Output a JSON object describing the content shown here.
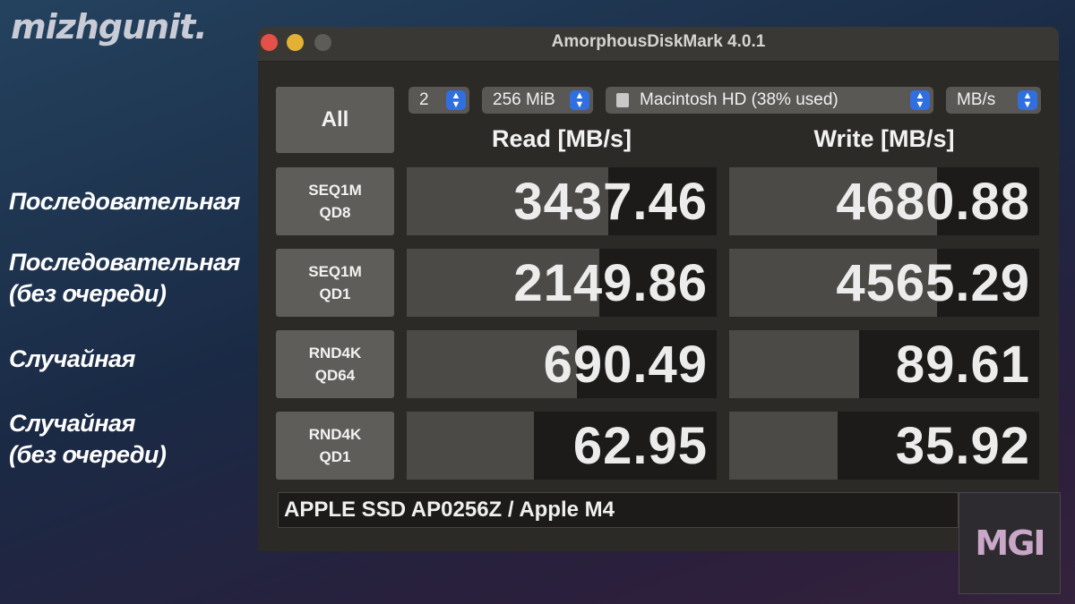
{
  "brand": "mizhgunit.",
  "side_labels": [
    {
      "line1": "Последовательная",
      "line2": ""
    },
    {
      "line1": "Последовательная",
      "line2": "(без очереди)"
    },
    {
      "line1": "Случайная",
      "line2": ""
    },
    {
      "line1": "Случайная",
      "line2": "(без очереди)"
    }
  ],
  "window": {
    "title": "AmorphousDiskMark 4.0.1",
    "all_label": "All",
    "selectors": {
      "count": "2",
      "size": "256 MiB",
      "disk": "Macintosh HD (38% used)",
      "unit": "MB/s"
    },
    "read_header": "Read [MB/s]",
    "write_header": "Write [MB/s]",
    "rows": [
      {
        "line1": "SEQ1M",
        "line2": "QD8",
        "read": "3437.46",
        "write": "4680.88",
        "read_fill": 0.65,
        "write_fill": 0.67
      },
      {
        "line1": "SEQ1M",
        "line2": "QD1",
        "read": "2149.86",
        "write": "4565.29",
        "read_fill": 0.62,
        "write_fill": 0.67
      },
      {
        "line1": "RND4K",
        "line2": "QD64",
        "read": "690.49",
        "write": "89.61",
        "read_fill": 0.55,
        "write_fill": 0.42
      },
      {
        "line1": "RND4K",
        "line2": "QD1",
        "read": "62.95",
        "write": "35.92",
        "read_fill": 0.41,
        "write_fill": 0.35
      }
    ],
    "device": "APPLE SSD AP0256Z / Apple M4"
  },
  "watermark": "MGI",
  "icons": {
    "close": "close-icon",
    "minimize": "minimize-icon",
    "zoom": "zoom-icon",
    "stepper": "chevron-up-down-icon",
    "disk": "hard-disk-icon"
  },
  "colors": {
    "window_bg": "#2c2a26",
    "cell_bg": "#1c1b19",
    "bar_fill": "#4c4a47",
    "accent": "#2f6fe0"
  }
}
